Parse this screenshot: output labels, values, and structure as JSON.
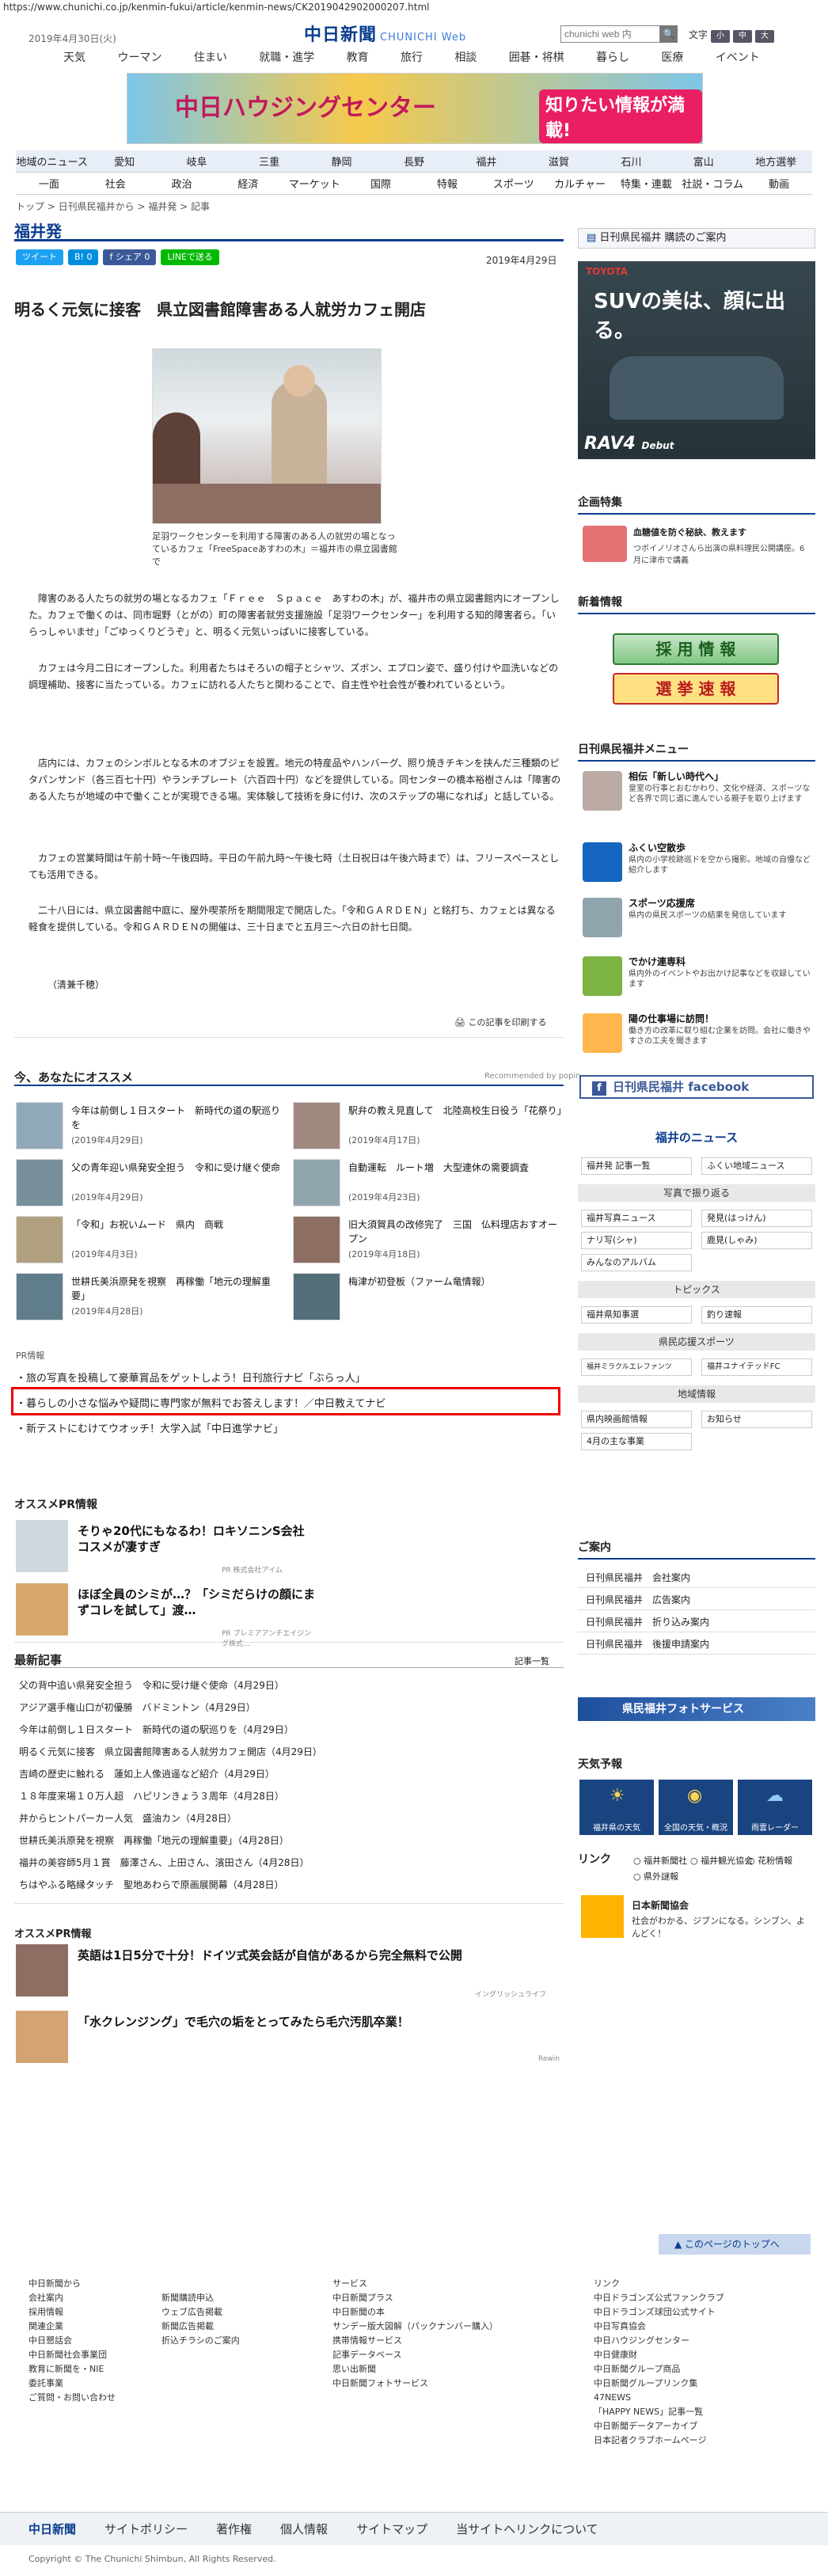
{
  "url": "https://www.chunichi.co.jp/kenmin-fukui/article/kenmin-news/CK2019042902000207.html",
  "header": {
    "date": "2019年4月30日(火)",
    "logo": "中日新聞",
    "logo_sub": "CHUNICHI Web",
    "search_placeholder": "chunichi web 内",
    "search_icon": "search-icon",
    "font_size_label": "文字",
    "font_small": "小",
    "font_mid": "中",
    "font_large": "大"
  },
  "global_nav": [
    "天気",
    "ウーマン",
    "住まい",
    "就職・進学",
    "教育",
    "旅行",
    "相談",
    "囲碁・将棋",
    "暮らし",
    "医療",
    "イベント"
  ],
  "banner": {
    "title": "中日ハウジングセンター",
    "tag": "知りたい情報が満載!"
  },
  "nav_row1": [
    "地域のニュース",
    "愛知",
    "岐阜",
    "三重",
    "静岡",
    "長野",
    "福井",
    "滋賀",
    "石川",
    "富山",
    "地方選挙"
  ],
  "nav_row2": [
    "一面",
    "社会",
    "政治",
    "経済",
    "マーケット",
    "国際",
    "特報",
    "スポーツ",
    "カルチャー",
    "特集・連載",
    "社説・コラム",
    "動画"
  ],
  "breadcrumb": "トップ > 日刊県民福井から > 福井発 > 記事",
  "page_heading": "福井発",
  "share": {
    "tweet": "ツイート",
    "hatena": "B! 0",
    "fb": "f シェア 0",
    "line": "LINEで送る"
  },
  "article": {
    "date": "2019年4月29日",
    "title": "明るく元気に接客　県立図書館障害ある人就労カフェ開店",
    "caption": "足羽ワークセンターを利用する障害のある人の就労の場となっているカフェ「FreeSpaceあすわの木」＝福井市の県立図書館で",
    "paragraphs": [
      "障害のある人たちの就労の場となるカフェ「Ｆｒｅｅ　Ｓｐａｃｅ　あすわの木」が、福井市の県立図書館内にオープンした。カフェで働くのは、同市堀野（とがの）町の障害者就労支援施設「足羽ワークセンター」を利用する知的障害者ら。「いらっしゃいませ」「ごゆっくりどうぞ」と、明るく元気いっぱいに接客している。",
      "カフェは今月二日にオープンした。利用者たちはそろいの帽子とシャツ、ズボン、エプロン姿で、盛り付けや皿洗いなどの調理補助、接客に当たっている。カフェに訪れる人たちと関わることで、自主性や社会性が養われているという。",
      "店内には、カフェのシンボルとなる木のオブジェを設置。地元の特産品やハンバーグ、照り焼きチキンを挟んだ三種類のピタパンサンド（各三百七十円）やランチプレート（六百四十円）などを提供している。同センターの橋本裕樹さんは「障害のある人たちが地域の中で働くことが実現できる場。実体験して技術を身に付け、次のステップの場になれば」と話している。",
      "カフェの営業時間は午前十時～午後四時。平日の午前九時～午後七時（土日祝日は午後六時まで）は、フリースペースとしても活用できる。",
      "二十八日には、県立図書館中庭に、屋外喫茶所を期間限定で開店した。「令和ＧＡＲＤＥＮ」と銘打ち、カフェとは異なる軽食を提供している。令和ＧＡＲＤＥＮの開催は、三十日までと五月三～六日の計七日間。",
      "（清兼千穂）"
    ],
    "print_label": "この記事を印刷する"
  },
  "recommend": {
    "heading": "今、あなたにオススメ",
    "powered": "Recommended by popin",
    "items": [
      {
        "title": "今年は前倒し１日スタート　新時代の道の駅巡りを",
        "date": "(2019年4月29日)"
      },
      {
        "title": "駅弁の教え見直して　北陸高校生日役う「花祭り」",
        "date": "(2019年4月17日)"
      },
      {
        "title": "父の青年迎い県発安全担う　令和に受け継ぐ使命",
        "date": "(2019年4月29日)"
      },
      {
        "title": "自動運転　ルート増　大型連休の需要調査",
        "date": "(2019年4月23日)"
      },
      {
        "title": "「令和」お祝いムード　県内　商戦",
        "date": "(2019年4月3日)"
      },
      {
        "title": "旧大須賀具の改修完了　三国　仏料理店おすオープン",
        "date": "(2019年4月18日)"
      },
      {
        "title": "世耕氏美浜原発を視察　再稼働「地元の理解重要」",
        "date": "(2019年4月28日)"
      },
      {
        "title": "梅津が初登板（ファーム竜情報）",
        "date": ""
      }
    ]
  },
  "pr": {
    "label": "PR情報",
    "lines": [
      "・旅の写真を投稿して豪華賞品をゲットしよう！日刊旅行ナビ「ぶらっ人」",
      "・暮らしの小さな悩みや疑問に専門家が無料でお答えします！／中日教えてナビ",
      "・新テストにむけてウオッチ！大学入試「中日進学ナビ」"
    ]
  },
  "osusume_pr": {
    "heading": "オススメPR情報",
    "items": [
      {
        "title": "そりゃ20代にもなるわ！ロキソニンS会社コスメが凄すぎ",
        "source": "PR 株式会社アイム"
      },
      {
        "title": "ほぼ全員のシミが…？「シミだらけの顔にまずコレを試して」渡…",
        "source": "PR プレミアアンチエイジング株式…"
      }
    ]
  },
  "latest": {
    "heading": "最新記事",
    "list_link": "記事一覧",
    "items": [
      "父の背中追い県発安全担う　令和に受け継ぐ使命（4月29日）",
      "アジア選手権山口が初優勝　バドミントン（4月29日）",
      "今年は前倒し１日スタート　新時代の道の駅巡りを（4月29日）",
      "明るく元気に接客　県立図書館障害ある人就労カフェ開店（4月29日）",
      "吉崎の歴史に触れる　蓮如上人像逍遥など紹介（4月29日）",
      "１８年度来場１０万人超　ハピリンきょう３周年（4月28日）",
      "井からヒントパーカー人気　盛油カン（4月28日）",
      "世耕氏美浜原発を視察　再稼働「地元の理解重要」（4月28日）",
      "福井の美容師5月１賞　藤澤さん、上田さん、濱田さん（4月28日）",
      "ちはやふる略縁タッチ　聖地あわらで原画展開幕（4月28日）"
    ]
  },
  "osusume_pr2": {
    "heading": "オススメPR情報",
    "items": [
      {
        "title": "英語は1日5分で十分！ドイツ式英会話が自信があるから完全無料で公開",
        "source": "イングリッシュライフ"
      },
      {
        "title": "「水クレンジング」で毛穴の垢をとってみたら毛穴汚肌卒業！",
        "source": "Rewin"
      }
    ]
  },
  "sidebar": {
    "kenmin_header": "日刊県民福井 購読のご案内",
    "ad_text": "SUVの美は、顔に出る。",
    "ad_brand": "RAV4",
    "ad_sub": "Debut",
    "kikaku_heading": "企画特集",
    "kikaku_title": "血糖値を防ぐ秘訣、教えます",
    "kikaku_desc": "つボイノリオさんら出演の県料理民公開講座。6月に津市で講義",
    "shincho_heading": "新着情報",
    "saiyo": "採 用 情 報",
    "senkyo": "選 挙 速 報",
    "menu_heading": "日刊県民福井メニュー",
    "menu": [
      {
        "title": "相伝「新しい時代へ」",
        "desc": "皇室の行事とおむかわり、文化や経済、スポーツなど各界で同じ道に進んでいる親子を取り上げます"
      },
      {
        "title": "ふくい空散歩",
        "desc": "県内の小学校跡巡ドを空から撮影。地域の自慢など紹介します"
      },
      {
        "title": "スポーツ応援席",
        "desc": "県内の県民スポーツの結果を発信しています"
      },
      {
        "title": "でかけ連専科",
        "desc": "県内外のイベントやお出かけ記事などを収録しています"
      },
      {
        "title": "陽の仕事場に訪問！",
        "desc": "働き方の改革に取り組む企業を訪問。会社に働きやすさの工夫を聞きます"
      }
    ],
    "facebook": "日刊県民福井 facebook",
    "fukui_news": "福井のニュース",
    "fukui_btns": [
      "福井発 記事一覧",
      "ふくい地域ニュース"
    ],
    "photo_cat": "写真で振り返る",
    "photo_btns": [
      "福井写真ニュース",
      "発見(はっけん)",
      "ナリ写(シャ)",
      "鹿見(しゃみ)",
      "みんなのアルバム"
    ],
    "topics_cat": "トピックス",
    "topics_btns": [
      "福井県知事選",
      "釣り速報"
    ],
    "sports_cat": "県民応援スポーツ",
    "sports_btns": [
      "福井ミラクルエレファンツ",
      "福井ユナイテッドFC"
    ],
    "region_cat": "地域情報",
    "region_btns": [
      "県内映画館情報",
      "お知らせ",
      "4月の主な事業"
    ],
    "guide_heading": "ご案内",
    "guide_items": [
      "日刊県民福井　会社案内",
      "日刊県民福井　広告案内",
      "日刊県民福井　折り込み案内",
      "日刊県民福井　後援申請案内"
    ],
    "photo_service": "県民福井フォトサービス",
    "weather_heading": "天気予報",
    "weather_btns": [
      "福井県の天気",
      "全国の天気・概況",
      "雨雲レーダー"
    ],
    "link_heading": "リンク",
    "link_items": [
      "福井新聞社",
      "福井観光協会",
      "花粉情報",
      "県外謎報"
    ],
    "nihon_title": "日本新聞協会",
    "nihon_desc": "社会がわかる、ジブンになる。シンブン、よんどく！"
  },
  "totop": "このページのトップへ",
  "footer": {
    "col1": [
      "中日新聞から",
      "会社案内",
      "採用情報",
      "関連企業",
      "中日懇話会",
      "中日新聞社会事業団",
      "教育に新聞を・NIE",
      "委託事業",
      "ご質問・お問い合わせ"
    ],
    "col2": [
      "新聞購読申込",
      "ウェブ広告掲載",
      "新聞広告掲載",
      "折込チラシのご案内"
    ],
    "col3": [
      "サービス",
      "中日新聞プラス",
      "中日新聞の本",
      "サンデー版大図解（パックナンバー購入）",
      "携帯情報サービス",
      "記事データベース",
      "思い出新聞",
      "中日新聞フォトサービス"
    ],
    "col4": [
      "リンク",
      "中日ドラゴンズ公式ファンクラブ",
      "中日ドラゴンズ球団公式サイト",
      "中日写真協会",
      "中日ハウジングセンター",
      "中日健康財",
      "中日新聞グループ商品",
      "中日新聞グループリンク集",
      "47NEWS",
      "「HAPPY NEWS」記事一覧",
      "中日新聞データアーカイブ",
      "日本記者クラブホームページ"
    ],
    "bar": [
      "中日新聞",
      "サイトポリシー",
      "著作権",
      "個人情報",
      "サイトマップ",
      "当サイトへリンクについて"
    ],
    "copyright": "Copyright © The Chunichi Shimbun, All Rights Reserved."
  }
}
